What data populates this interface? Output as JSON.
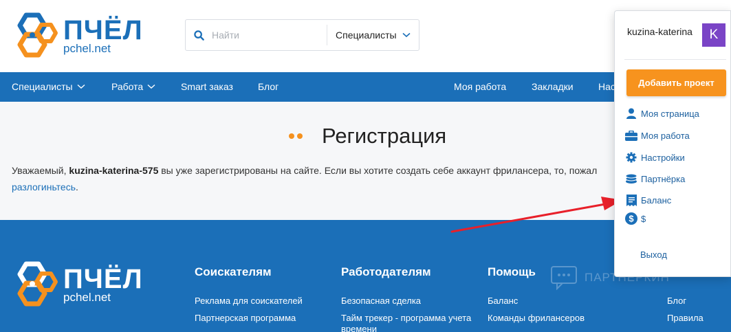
{
  "brand": {
    "name": "ПЧЁЛ",
    "domain": "pchel.net",
    "color": "#1b6fb8",
    "accent": "#f5911e"
  },
  "search": {
    "placeholder": "Найти",
    "category": "Специалисты"
  },
  "nav": {
    "items": [
      {
        "label": "Специалисты",
        "has_dropdown": true
      },
      {
        "label": "Работа",
        "has_dropdown": true
      },
      {
        "label": "Smart заказ",
        "has_dropdown": false
      },
      {
        "label": "Блог",
        "has_dropdown": false
      },
      {
        "label": "Моя работа",
        "has_dropdown": false
      },
      {
        "label": "Закладки",
        "has_dropdown": false
      },
      {
        "label": "Нас",
        "has_dropdown": false
      }
    ]
  },
  "page": {
    "title": "Регистрация",
    "message_prefix": "Уважаемый, ",
    "message_user": "kuzina-katerina-575",
    "message_suffix": " вы уже зарегистрированы на сайте. Если вы хотите создать себе аккаунт фрилансера, то, пожал",
    "logout_link": "разлогиньтесь",
    "logout_tail": "."
  },
  "footer": {
    "columns": [
      {
        "title": "Соискателям",
        "links": [
          "Реклама для соискателей",
          "Партнерская программа"
        ]
      },
      {
        "title": "Работодателям",
        "links": [
          "Безопасная сделка",
          "Тайм трекер - программа учета времени"
        ]
      },
      {
        "title": "Помощь",
        "links": [
          "Баланс",
          "Команды фрилансеров"
        ]
      },
      {
        "title": "",
        "links": [
          "Блог",
          "Правила"
        ]
      }
    ],
    "watermark": "ПАРТНЕРКИН"
  },
  "user_menu": {
    "username": "kuzina-katerina",
    "avatar_letter": "K",
    "avatar_color": "#7a44c6",
    "add_project": "Добавить проект",
    "add_project_color": "#f7931e",
    "items": [
      {
        "label": "Моя страница",
        "icon": "user-icon"
      },
      {
        "label": "Моя работа",
        "icon": "briefcase-icon"
      },
      {
        "label": "Настройки",
        "icon": "gear-icon"
      },
      {
        "label": "Партнёрка",
        "icon": "coins-icon"
      },
      {
        "label": "Баланс",
        "icon": "receipt-icon"
      },
      {
        "label": "$",
        "icon": "dollar-icon"
      }
    ],
    "logout": "Выход"
  },
  "annotation": {
    "color": "#e8202a"
  }
}
